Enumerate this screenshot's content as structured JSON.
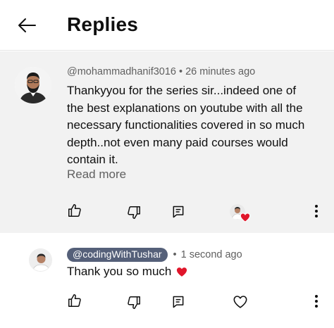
{
  "header": {
    "back_icon": "arrow-left-icon",
    "title": "Replies"
  },
  "parent_comment": {
    "author": "@mohammadhanif3016",
    "separator": "•",
    "time": "26 minutes ago",
    "text": "Thankyyou for the series sir...indeed one of the best explanations on youtube with all the necessary functionalities covered in so much depth..not even many paid courses would contain it.",
    "read_more": "Read more",
    "actions": {
      "like_icon": "thumbs-up-icon",
      "dislike_icon": "thumbs-down-icon",
      "reply_icon": "reply-icon",
      "creator_heart_icon": "creator-heart-icon",
      "more_icon": "more-vertical-icon"
    }
  },
  "reply": {
    "author": "@codingWithTushar",
    "separator": "•",
    "time": "1 second ago",
    "text": "Thank you so much",
    "emoji": "red-heart",
    "actions": {
      "like_icon": "thumbs-up-icon",
      "dislike_icon": "thumbs-down-icon",
      "reply_icon": "reply-icon",
      "heart_icon": "heart-outline-icon",
      "more_icon": "more-vertical-icon"
    }
  },
  "colors": {
    "background": "#ffffff",
    "parent_background": "#f2f2f2",
    "text_primary": "#0f0f0f",
    "text_secondary": "#606060",
    "creator_chip": "#556079",
    "heart_red": "#e0162b"
  }
}
